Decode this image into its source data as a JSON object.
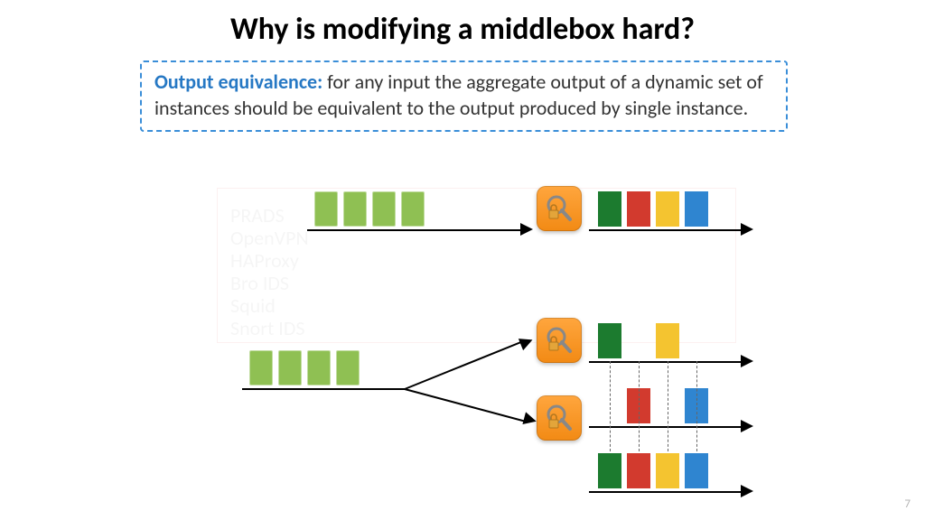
{
  "title": "Why is modifying a middlebox hard?",
  "callout": {
    "lead": "Output equivalence:",
    "rest": " for any input the aggregate output of a dynamic set of instances should be equivalent to the output produced by single instance."
  },
  "page_number": "7",
  "colors": {
    "packet_in": "#8fc053",
    "out_green": "#1c7b2f",
    "out_red": "#d23a2e",
    "out_yellow": "#f4c430",
    "out_blue": "#2f85d0",
    "accent_border": "#3a8ed8"
  },
  "diagram": {
    "top": {
      "input_packets": 4,
      "output_sequence": [
        "green",
        "red",
        "yellow",
        "blue"
      ]
    },
    "bottom": {
      "input_packets": 4,
      "instances": 2,
      "outputs": {
        "instance1": [
          "green",
          null,
          "yellow",
          null
        ],
        "instance2": [
          null,
          "red",
          null,
          "blue"
        ]
      },
      "recombined": [
        "green",
        "red",
        "yellow",
        "blue"
      ]
    }
  },
  "ghost_labels": [
    "PRADS",
    "OpenVPN",
    "HAProxy",
    "Bro IDS",
    "Squid",
    "Snort IDS"
  ]
}
